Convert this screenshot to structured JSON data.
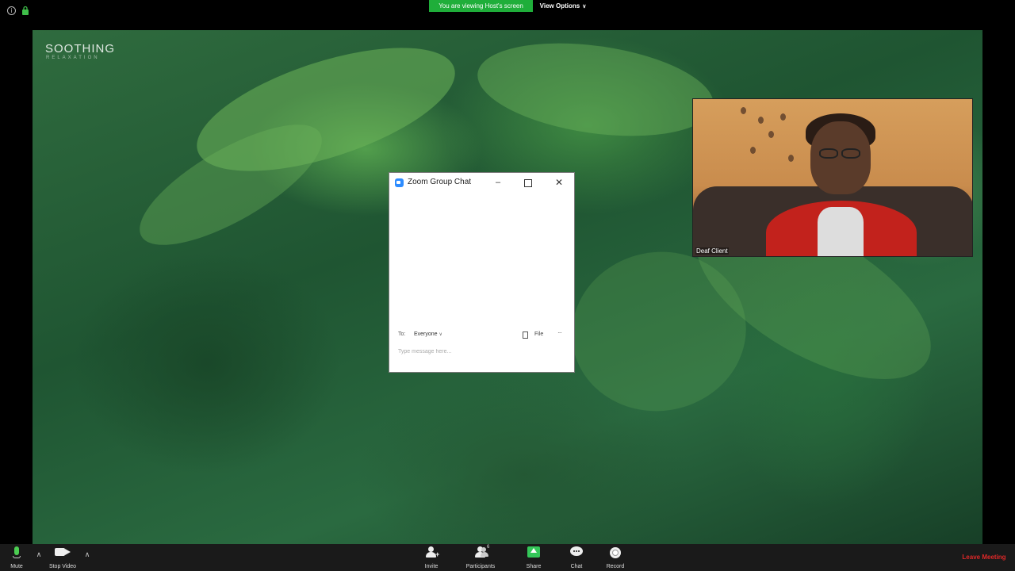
{
  "top_bar": {
    "viewing_banner": "You are viewing Host's screen",
    "view_options": "View Options"
  },
  "shared_screen": {
    "brand_title": "SOOTHING",
    "brand_subtitle": "RELAXATION"
  },
  "chat_window": {
    "title": "Zoom Group Chat",
    "to_label": "To:",
    "recipient": "Everyone",
    "file_label": "File",
    "more": "···",
    "message_placeholder": "Type message here..."
  },
  "participant_video": {
    "name": "Deaf Client"
  },
  "toolbar": {
    "mute": "Mute",
    "stop_video": "Stop Video",
    "invite": "Invite",
    "participants": "Participants",
    "participants_count": "6",
    "share": "Share",
    "chat": "Chat",
    "record": "Record",
    "leave": "Leave Meeting"
  },
  "colors": {
    "viewing_banner_bg": "#1fae3a",
    "leave_text": "#e02828",
    "mic_active": "#4ccd52",
    "share_green": "#34c759",
    "zoom_blue": "#2d8cff"
  }
}
